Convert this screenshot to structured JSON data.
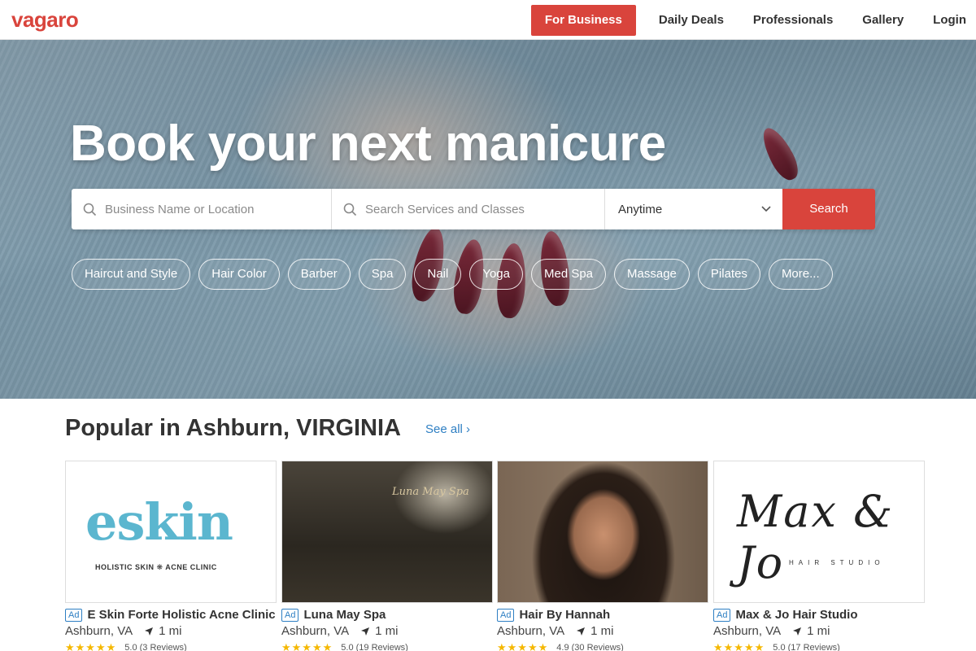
{
  "header": {
    "logo": "vagaro",
    "for_business": "For Business",
    "nav": [
      "Daily Deals",
      "Professionals",
      "Gallery",
      "Login"
    ]
  },
  "hero": {
    "title": "Book your next manicure",
    "search": {
      "location_placeholder": "Business Name or Location",
      "service_placeholder": "Search Services and Classes",
      "time_value": "Anytime",
      "button": "Search"
    },
    "chips": [
      "Haircut and Style",
      "Hair Color",
      "Barber",
      "Spa",
      "Nail",
      "Yoga",
      "Med Spa",
      "Massage",
      "Pilates",
      "More..."
    ]
  },
  "popular": {
    "title": "Popular in Ashburn, VIRGINIA",
    "see_all": "See all",
    "cards": [
      {
        "ad": "Ad",
        "name": "E Skin Forte Holistic Acne Clinic",
        "location": "Ashburn, VA",
        "distance": "1 mi",
        "rating_text": "5.0 (3 Reviews)",
        "logo_word": "eskin",
        "logo_sub": "HOLISTIC SKIN ❋ ACNE CLINIC"
      },
      {
        "ad": "Ad",
        "name": "Luna May Spa",
        "location": "Ashburn, VA",
        "distance": "1 mi",
        "rating_text": "5.0 (19 Reviews)",
        "logo_word": "Luna May Spa"
      },
      {
        "ad": "Ad",
        "name": "Hair By Hannah",
        "location": "Ashburn, VA",
        "distance": "1 mi",
        "rating_text": "4.9 (30 Reviews)"
      },
      {
        "ad": "Ad",
        "name": "Max & Jo Hair Studio",
        "location": "Ashburn, VA",
        "distance": "1 mi",
        "rating_text": "5.0 (17 Reviews)",
        "logo_word": "Max & Jo",
        "logo_sub": "HAIR STUDIO"
      }
    ]
  },
  "colors": {
    "brand": "#d9443c",
    "link": "#2e7fc3",
    "star": "#f5b800"
  }
}
